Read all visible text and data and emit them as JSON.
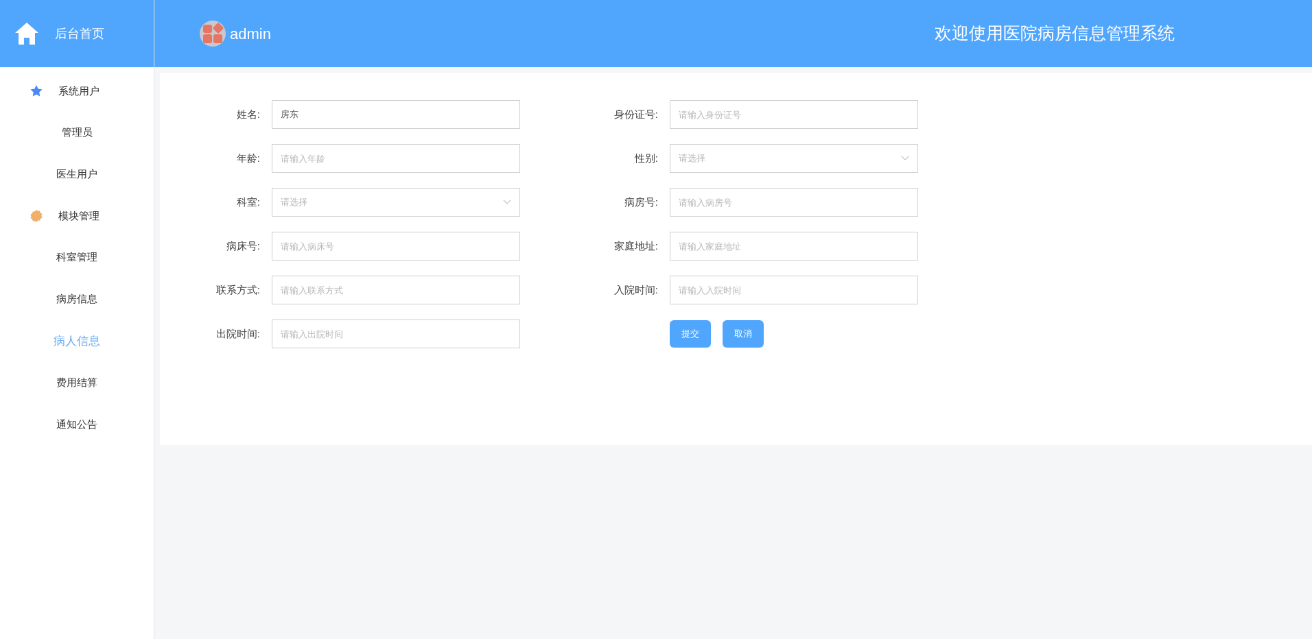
{
  "sidebar": {
    "home": "后台首页",
    "groups": [
      {
        "label": "系统用户",
        "color": "#4a8af4",
        "children": [
          {
            "label": "管理员",
            "selected": false
          },
          {
            "label": "医生用户",
            "selected": false
          }
        ]
      },
      {
        "label": "模块管理",
        "color": "#f0b06a",
        "children": [
          {
            "label": "科室管理",
            "selected": false
          },
          {
            "label": "病房信息",
            "selected": false
          },
          {
            "label": "病人信息",
            "selected": true
          },
          {
            "label": "费用结算",
            "selected": false
          },
          {
            "label": "通知公告",
            "selected": false
          }
        ]
      }
    ]
  },
  "header": {
    "user": "admin",
    "title": "欢迎使用医院病房信息管理系统"
  },
  "form": {
    "fields": [
      {
        "label": "姓名:",
        "kind": "input",
        "value": "房东"
      },
      {
        "label": "身份证号:",
        "kind": "input",
        "placeholder": "请输入身份证号"
      },
      {
        "label": "年龄:",
        "kind": "input",
        "placeholder": "请输入年龄"
      },
      {
        "label": "性别:",
        "kind": "select",
        "placeholder": "请选择"
      },
      {
        "label": "科室:",
        "kind": "select",
        "placeholder": "请选择"
      },
      {
        "label": "病房号:",
        "kind": "input",
        "placeholder": "请输入病房号"
      },
      {
        "label": "病床号:",
        "kind": "input",
        "placeholder": "请输入病床号"
      },
      {
        "label": "家庭地址:",
        "kind": "input",
        "placeholder": "请输入家庭地址"
      },
      {
        "label": "联系方式:",
        "kind": "input",
        "placeholder": "请输入联系方式"
      },
      {
        "label": "入院时间:",
        "kind": "input",
        "placeholder": "请输入入院时间"
      },
      {
        "label": "出院时间:",
        "kind": "input",
        "placeholder": "请输入出院时间"
      }
    ],
    "buttons": [
      "提交",
      "取消"
    ]
  }
}
